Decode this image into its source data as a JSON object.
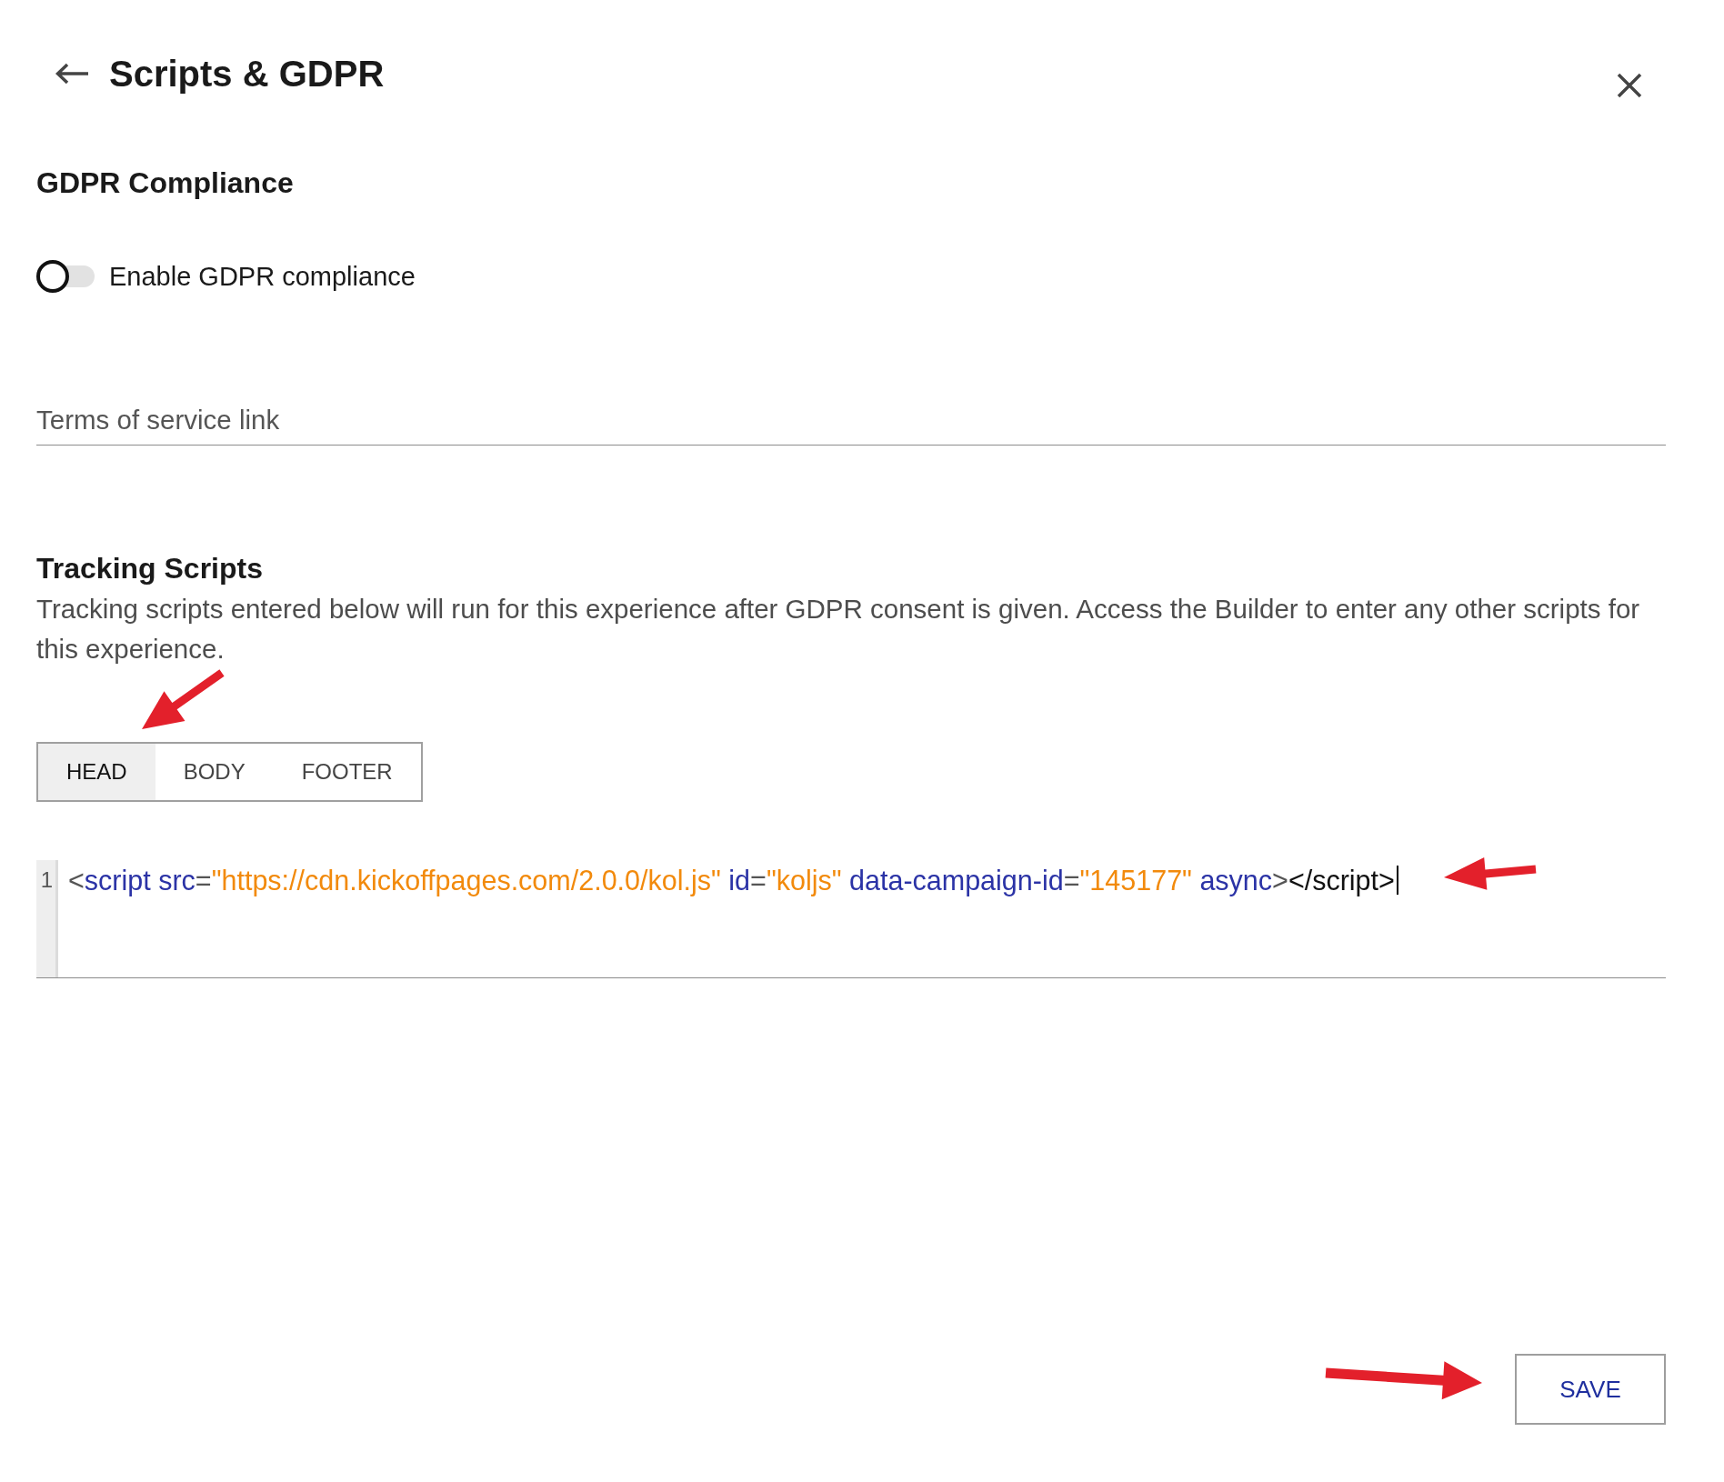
{
  "header": {
    "title": "Scripts & GDPR"
  },
  "gdpr": {
    "heading": "GDPR Compliance",
    "toggle": {
      "label": "Enable GDPR compliance",
      "on": false
    },
    "terms_field": {
      "placeholder": "Terms of service link"
    }
  },
  "tracking": {
    "heading": "Tracking Scripts",
    "description": "Tracking scripts entered below will run for this experience after GDPR consent is given. Access the Builder to enter any other scripts for this experience.",
    "tabs": [
      {
        "label": "HEAD",
        "selected": true
      },
      {
        "label": "BODY",
        "selected": false
      },
      {
        "label": "FOOTER",
        "selected": false
      }
    ],
    "editor": {
      "lines": [
        {
          "number": "1",
          "cursor": true,
          "tokens": [
            {
              "kind": "bracket",
              "text": "<"
            },
            {
              "kind": "tag",
              "text": "script"
            },
            {
              "kind": "attribute",
              "text": " src"
            },
            {
              "kind": "operator",
              "text": "="
            },
            {
              "kind": "string",
              "text": "\"https://cdn.kickoffpages.com/2.0.0/kol.js\""
            },
            {
              "kind": "attribute",
              "text": " id"
            },
            {
              "kind": "operator",
              "text": "="
            },
            {
              "kind": "string",
              "text": "\"koljs\""
            },
            {
              "kind": "attribute",
              "text": " data-campaign-id"
            },
            {
              "kind": "operator",
              "text": "="
            },
            {
              "kind": "string",
              "text": "\"145177\""
            },
            {
              "kind": "attribute",
              "text": " async"
            },
            {
              "kind": "bracket",
              "text": ">"
            },
            {
              "kind": "text",
              "text": "</script>"
            }
          ]
        }
      ]
    }
  },
  "footer": {
    "save_button": "SAVE"
  }
}
